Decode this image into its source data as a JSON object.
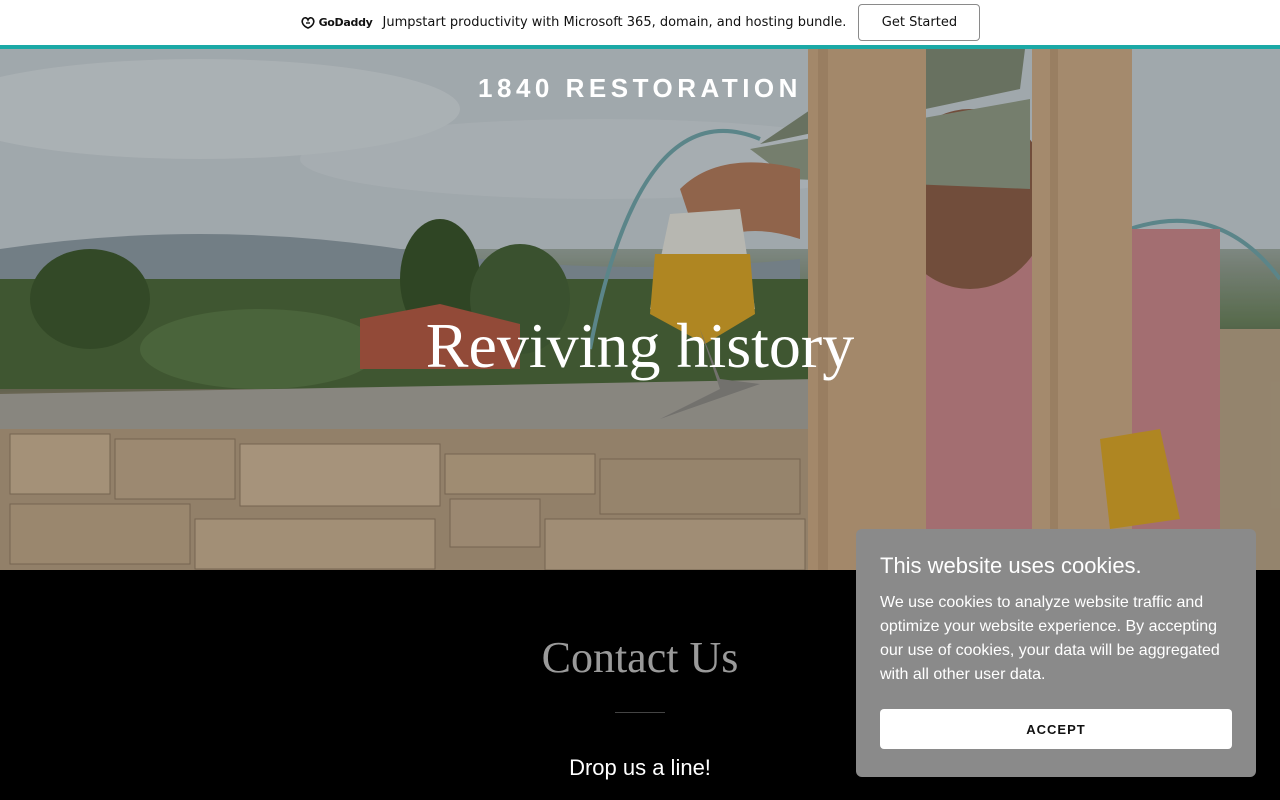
{
  "promo": {
    "logo_text": "GoDaddy",
    "logo_icon": "godaddy-logo-icon",
    "message": "Jumpstart productivity with Microsoft 365, domain, and hosting bundle.",
    "cta_label": "Get Started",
    "accent_color": "#1ba9a6"
  },
  "hero": {
    "site_title": "1840 RESTORATION",
    "heading": "Reviving history"
  },
  "contact": {
    "title": "Contact Us",
    "subtitle": "Drop us a line!"
  },
  "cookie_banner": {
    "title": "This website uses cookies.",
    "body": "We use cookies to analyze website traffic and optimize your website experience. By accepting our use of cookies, your data will be aggregated with all other user data.",
    "accept_label": "ACCEPT",
    "background_color": "#8a8a8a"
  }
}
